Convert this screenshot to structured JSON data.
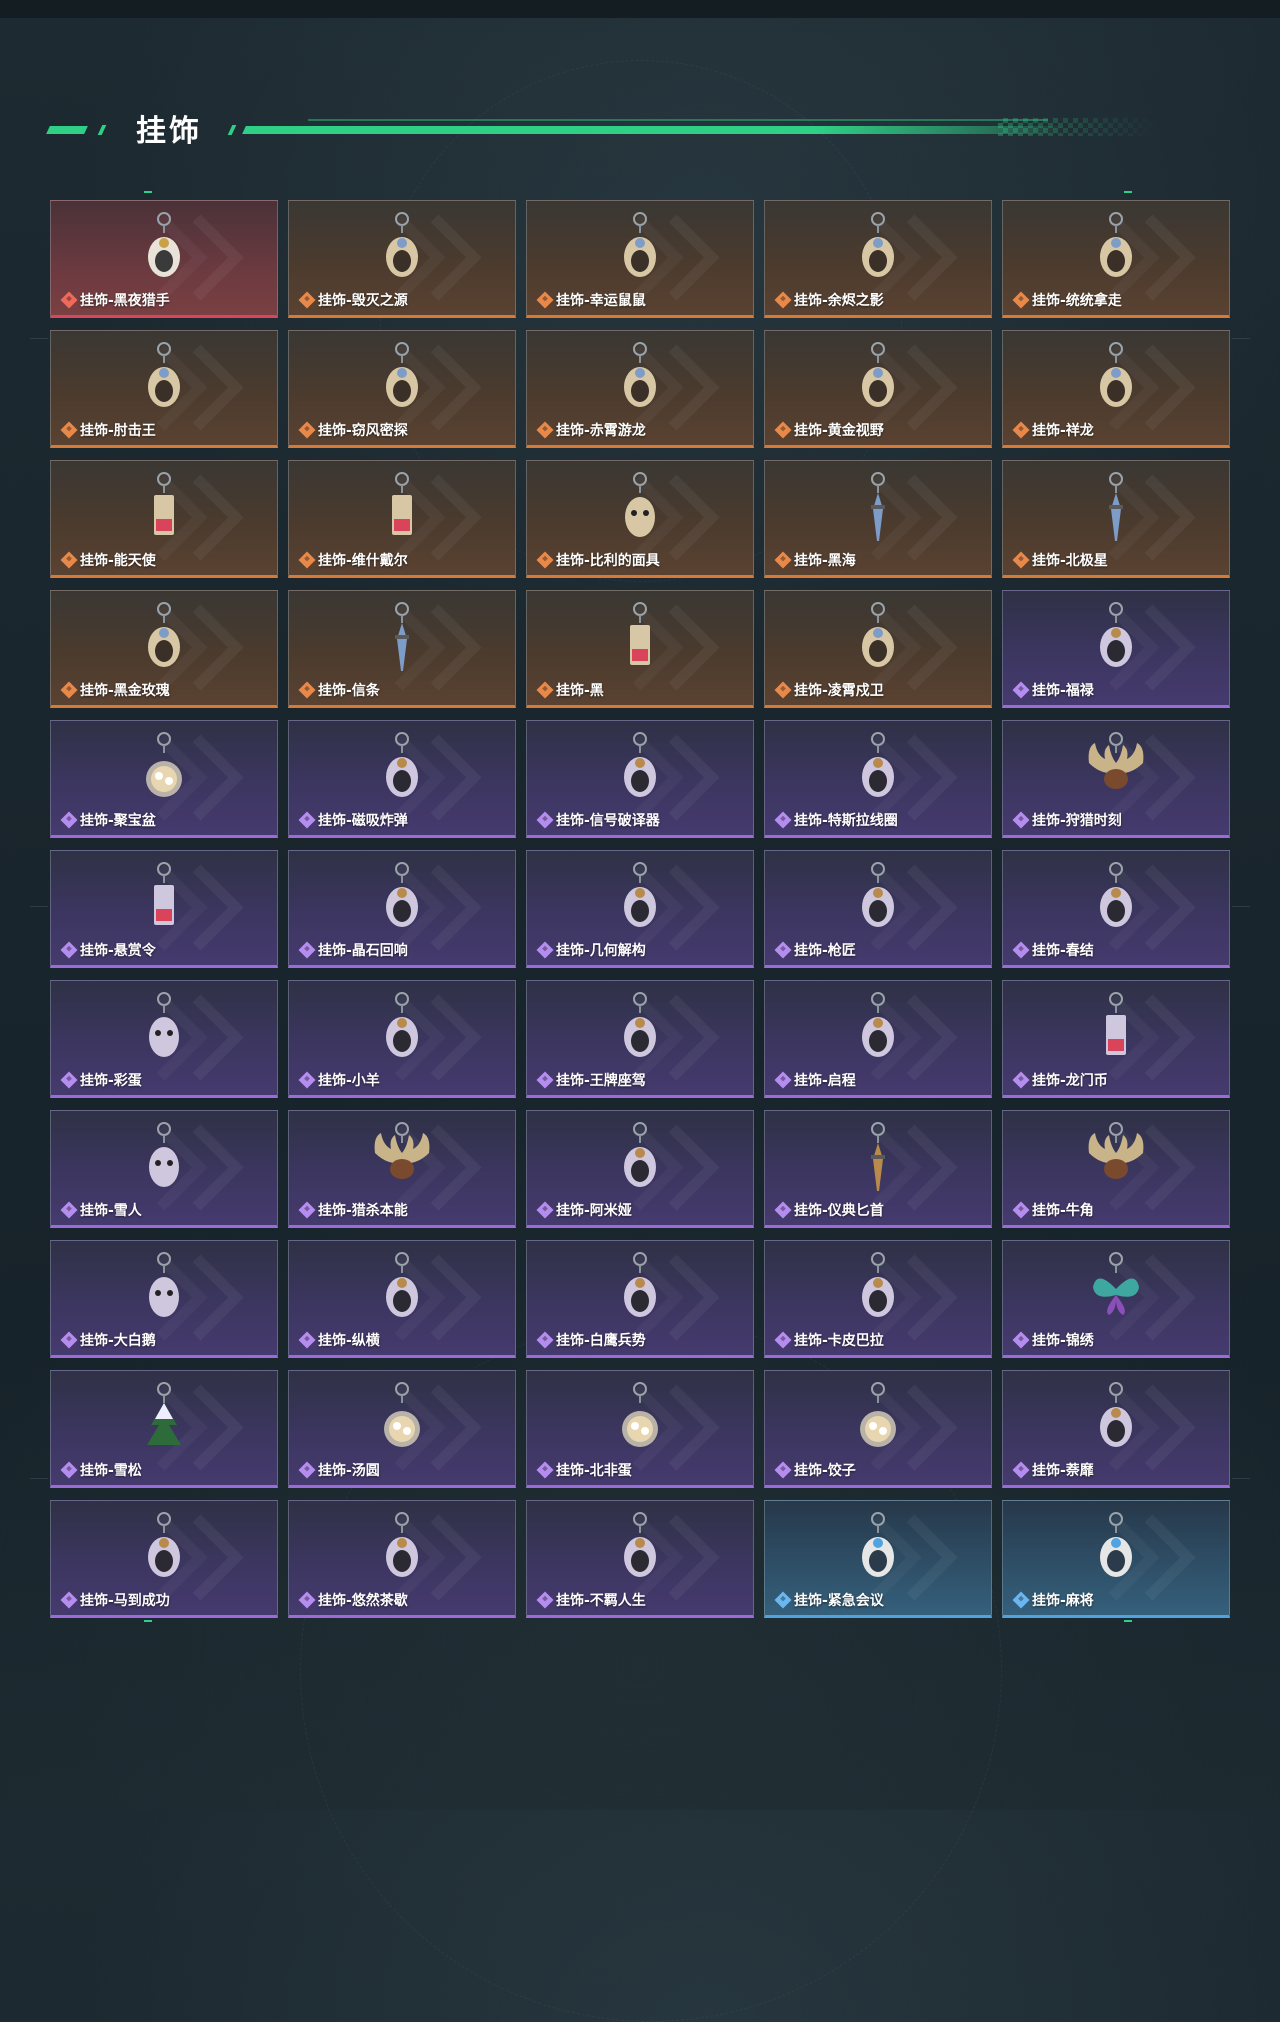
{
  "section": {
    "title": "挂饰"
  },
  "items": [
    {
      "name": "挂饰-黑夜猎手",
      "rarity": "red",
      "icon": "soldier-charm-icon"
    },
    {
      "name": "挂饰-毁灭之源",
      "rarity": "orange",
      "icon": "dragon-charm-icon"
    },
    {
      "name": "挂饰-幸运鼠鼠",
      "rarity": "orange",
      "icon": "rat-charm-icon"
    },
    {
      "name": "挂饰-余烬之影",
      "rarity": "orange",
      "icon": "warrior-charm-icon"
    },
    {
      "name": "挂饰-统统拿走",
      "rarity": "orange",
      "icon": "robot-charm-icon"
    },
    {
      "name": "挂饰-肘击王",
      "rarity": "orange",
      "icon": "bird-charm-icon"
    },
    {
      "name": "挂饰-窃风密探",
      "rarity": "orange",
      "icon": "rabbit-charm-icon"
    },
    {
      "name": "挂饰-赤霄游龙",
      "rarity": "orange",
      "icon": "lion-charm-icon"
    },
    {
      "name": "挂饰-黄金视野",
      "rarity": "orange",
      "icon": "duck-charm-icon"
    },
    {
      "name": "挂饰-祥龙",
      "rarity": "orange",
      "icon": "dragon-charm-icon"
    },
    {
      "name": "挂饰-能天使",
      "rarity": "orange",
      "icon": "tag-charm-icon"
    },
    {
      "name": "挂饰-维什戴尔",
      "rarity": "orange",
      "icon": "tag-charm-icon"
    },
    {
      "name": "挂饰-比利的面具",
      "rarity": "orange",
      "icon": "mask-charm-icon"
    },
    {
      "name": "挂饰-黑海",
      "rarity": "orange",
      "icon": "anchor-charm-icon"
    },
    {
      "name": "挂饰-北极星",
      "rarity": "orange",
      "icon": "star-charm-icon"
    },
    {
      "name": "挂饰-黑金玫瑰",
      "rarity": "orange",
      "icon": "rose-charm-icon"
    },
    {
      "name": "挂饰-信条",
      "rarity": "orange",
      "icon": "blade-charm-icon"
    },
    {
      "name": "挂饰-黑",
      "rarity": "orange",
      "icon": "tag-charm-icon"
    },
    {
      "name": "挂饰-凌霄戍卫",
      "rarity": "orange",
      "icon": "rocket-charm-icon"
    },
    {
      "name": "挂饰-福禄",
      "rarity": "purple",
      "icon": "gourd-charm-icon"
    },
    {
      "name": "挂饰-聚宝盆",
      "rarity": "purple",
      "icon": "bowl-charm-icon"
    },
    {
      "name": "挂饰-磁吸炸弹",
      "rarity": "purple",
      "icon": "bomb-charm-icon"
    },
    {
      "name": "挂饰-信号破译器",
      "rarity": "purple",
      "icon": "device-charm-icon"
    },
    {
      "name": "挂饰-特斯拉线圈",
      "rarity": "purple",
      "icon": "coil-charm-icon"
    },
    {
      "name": "挂饰-狩猎时刻",
      "rarity": "purple",
      "icon": "antler-charm-icon"
    },
    {
      "name": "挂饰-悬赏令",
      "rarity": "purple",
      "icon": "scroll-charm-icon"
    },
    {
      "name": "挂饰-晶石回响",
      "rarity": "purple",
      "icon": "crystal-charm-icon"
    },
    {
      "name": "挂饰-几何解构",
      "rarity": "purple",
      "icon": "geometry-charm-icon"
    },
    {
      "name": "挂饰-枪匠",
      "rarity": "purple",
      "icon": "box-charm-icon"
    },
    {
      "name": "挂饰-春结",
      "rarity": "purple",
      "icon": "knot-charm-icon"
    },
    {
      "name": "挂饰-彩蛋",
      "rarity": "purple",
      "icon": "egg-charm-icon"
    },
    {
      "name": "挂饰-小羊",
      "rarity": "purple",
      "icon": "sheep-charm-icon"
    },
    {
      "name": "挂饰-王牌座驾",
      "rarity": "purple",
      "icon": "plane-charm-icon"
    },
    {
      "name": "挂饰-启程",
      "rarity": "purple",
      "icon": "compass-charm-icon"
    },
    {
      "name": "挂饰-龙门币",
      "rarity": "purple",
      "icon": "card-charm-icon"
    },
    {
      "name": "挂饰-雪人",
      "rarity": "purple",
      "icon": "snowman-charm-icon"
    },
    {
      "name": "挂饰-猎杀本能",
      "rarity": "purple",
      "icon": "antler-charm-icon"
    },
    {
      "name": "挂饰-阿米娅",
      "rarity": "purple",
      "icon": "bunny-charm-icon"
    },
    {
      "name": "挂饰-仪典匕首",
      "rarity": "purple",
      "icon": "dagger-charm-icon"
    },
    {
      "name": "挂饰-牛角",
      "rarity": "purple",
      "icon": "horn-charm-icon"
    },
    {
      "name": "挂饰-大白鹅",
      "rarity": "purple",
      "icon": "goose-charm-icon"
    },
    {
      "name": "挂饰-纵横",
      "rarity": "purple",
      "icon": "figure-charm-icon"
    },
    {
      "name": "挂饰-白鹰兵势",
      "rarity": "purple",
      "icon": "logo-charm-icon"
    },
    {
      "name": "挂饰-卡皮巴拉",
      "rarity": "purple",
      "icon": "capybara-charm-icon"
    },
    {
      "name": "挂饰-锦绣",
      "rarity": "purple",
      "icon": "butterfly-charm-icon"
    },
    {
      "name": "挂饰-雪松",
      "rarity": "purple",
      "icon": "tree-charm-icon"
    },
    {
      "name": "挂饰-汤圆",
      "rarity": "purple",
      "icon": "dumpling-bowl-charm-icon"
    },
    {
      "name": "挂饰-北非蛋",
      "rarity": "purple",
      "icon": "pan-charm-icon"
    },
    {
      "name": "挂饰-饺子",
      "rarity": "purple",
      "icon": "plate-charm-icon"
    },
    {
      "name": "挂饰-萘靡",
      "rarity": "purple",
      "icon": "flower-charm-icon"
    },
    {
      "name": "挂饰-马到成功",
      "rarity": "purple",
      "icon": "horse-charm-icon"
    },
    {
      "name": "挂饰-悠然茶歇",
      "rarity": "purple",
      "icon": "cupcake-charm-icon"
    },
    {
      "name": "挂饰-不羁人生",
      "rarity": "purple",
      "icon": "sneaker-charm-icon"
    },
    {
      "name": "挂饰-紧急会议",
      "rarity": "blue",
      "icon": "badge-charm-icon"
    },
    {
      "name": "挂饰-麻将",
      "rarity": "blue",
      "icon": "mahjong-charm-icon"
    }
  ],
  "colors": {
    "accent": "#2fcf86",
    "orange": "#d67a36",
    "red": "#d9455b",
    "purple": "#9b6bd9",
    "blue": "#4fa3e0"
  }
}
